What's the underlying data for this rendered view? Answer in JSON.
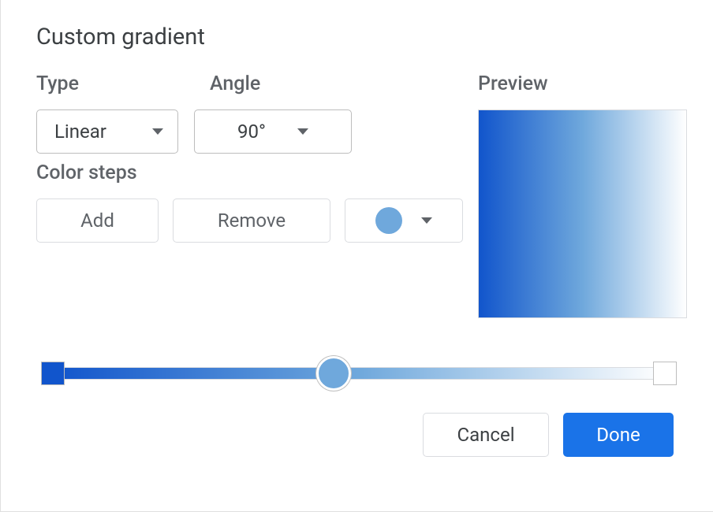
{
  "title": "Custom gradient",
  "labels": {
    "type": "Type",
    "angle": "Angle",
    "preview": "Preview",
    "color_steps": "Color steps"
  },
  "type_select": {
    "value": "Linear"
  },
  "angle_select": {
    "value": "90°"
  },
  "buttons": {
    "add": "Add",
    "remove": "Remove",
    "cancel": "Cancel",
    "done": "Done"
  },
  "colors": {
    "gradient_start": "#1155cc",
    "gradient_mid": "#6fa8dc",
    "gradient_end": "#ffffff",
    "selected_swatch": "#6fa8dc",
    "primary_button": "#1a73e8"
  },
  "gradient_stops": [
    {
      "position": 0,
      "color": "#1155cc"
    },
    {
      "position": 50,
      "color": "#6fa8dc"
    },
    {
      "position": 100,
      "color": "#ffffff"
    }
  ],
  "slider_thumb_position_pct": 46
}
